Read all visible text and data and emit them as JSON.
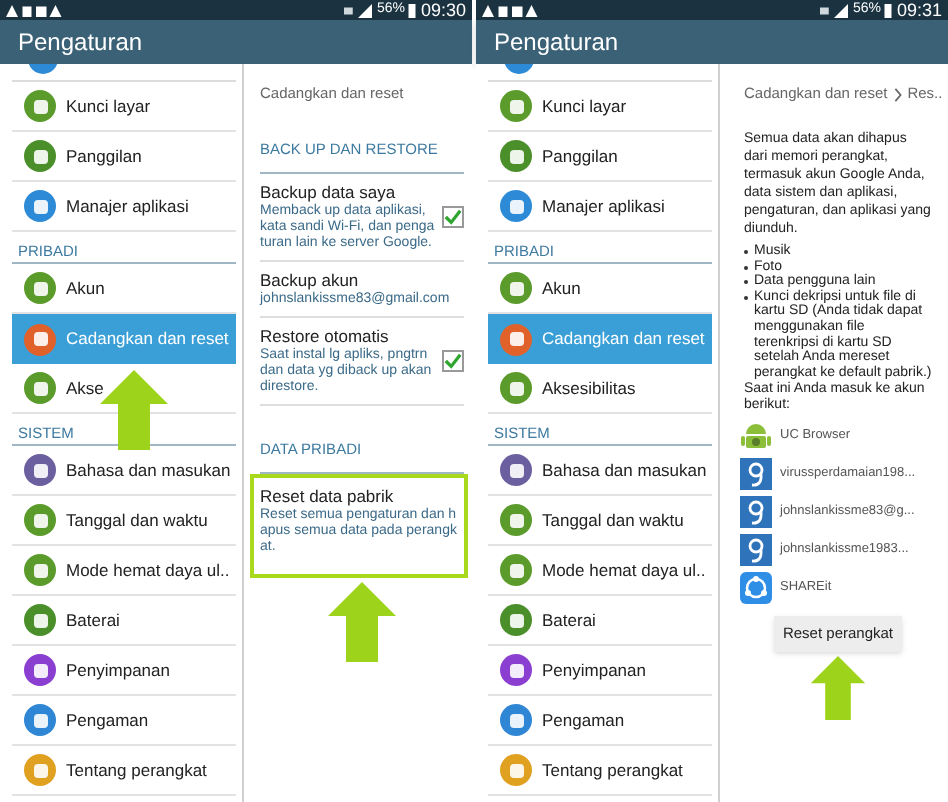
{
  "screens": [
    {
      "status_bar": {
        "battery": "56%",
        "time": "09:30"
      },
      "title": "Pengaturan",
      "list_arrow": true,
      "menu": [
        {
          "kind": "item",
          "label": "Kunci layar",
          "color": "#5b9b2b",
          "selected": false
        },
        {
          "kind": "item",
          "label": "Panggilan",
          "color": "#4b8f2a",
          "selected": false
        },
        {
          "kind": "item",
          "label": "Manajer aplikasi",
          "color": "#2d8ad6",
          "selected": false
        },
        {
          "kind": "header",
          "label": "PRIBADI"
        },
        {
          "kind": "item",
          "label": "Akun",
          "color": "#5b9b2b",
          "selected": false
        },
        {
          "kind": "item",
          "label": "Cadangkan dan reset",
          "color": "#e0622a",
          "selected": true
        },
        {
          "kind": "item",
          "label": "Akse",
          "color": "#5b9b2b",
          "selected": false
        },
        {
          "kind": "header",
          "label": "SISTEM"
        },
        {
          "kind": "item",
          "label": "Bahasa dan masukan",
          "color": "#6b5fa0",
          "selected": false
        },
        {
          "kind": "item",
          "label": "Tanggal dan waktu",
          "color": "#5b9b2b",
          "selected": false
        },
        {
          "kind": "item",
          "label": "Mode hemat daya ul..",
          "color": "#5b9b2b",
          "selected": false
        },
        {
          "kind": "item",
          "label": "Baterai",
          "color": "#4b8f2a",
          "selected": false
        },
        {
          "kind": "item",
          "label": "Penyimpanan",
          "color": "#8a3fd0",
          "selected": false
        },
        {
          "kind": "item",
          "label": "Pengaman",
          "color": "#2e86d4",
          "selected": false
        },
        {
          "kind": "item",
          "label": "Tentang perangkat",
          "color": "#e0a020",
          "selected": false
        }
      ],
      "detail": {
        "kind": "backup",
        "breadcrumb": [
          "Cadangkan dan reset"
        ],
        "sections": [
          {
            "header": "BACK UP DAN RESTORE",
            "items": [
              {
                "title": "Backup data saya",
                "description": "Memback up data aplikasi, kata sandi Wi-Fi, dan pengaturan lain ke server Google.",
                "checked": true,
                "highlighted": false
              },
              {
                "title": "Backup akun",
                "description": "johnslankissme83@gmail.com",
                "highlighted": false
              },
              {
                "title": "Restore otomatis",
                "description": "Saat instal lg apliks, pngtrn dan data yg diback up akan direstore.",
                "checked": true,
                "highlighted": false
              }
            ]
          },
          {
            "header": "DATA PRIBADI",
            "items": [
              {
                "title": "Reset data pabrik",
                "description": "Reset semua pengaturan dan hapus semua data pada perangkat.",
                "highlighted": true
              }
            ]
          }
        ]
      }
    },
    {
      "status_bar": {
        "battery": "56%",
        "time": "09:31"
      },
      "title": "Pengaturan",
      "menu": [
        {
          "kind": "item",
          "label": "Kunci layar",
          "color": "#5b9b2b",
          "selected": false
        },
        {
          "kind": "item",
          "label": "Panggilan",
          "color": "#4b8f2a",
          "selected": false
        },
        {
          "kind": "item",
          "label": "Manajer aplikasi",
          "color": "#2d8ad6",
          "selected": false
        },
        {
          "kind": "header",
          "label": "PRIBADI"
        },
        {
          "kind": "item",
          "label": "Akun",
          "color": "#5b9b2b",
          "selected": false
        },
        {
          "kind": "item",
          "label": "Cadangkan dan reset",
          "color": "#e0622a",
          "selected": true
        },
        {
          "kind": "item",
          "label": "Aksesibilitas",
          "color": "#5b9b2b",
          "selected": false
        },
        {
          "kind": "header",
          "label": "SISTEM"
        },
        {
          "kind": "item",
          "label": "Bahasa dan masukan",
          "color": "#6b5fa0",
          "selected": false
        },
        {
          "kind": "item",
          "label": "Tanggal dan waktu",
          "color": "#5b9b2b",
          "selected": false
        },
        {
          "kind": "item",
          "label": "Mode hemat daya ul..",
          "color": "#5b9b2b",
          "selected": false
        },
        {
          "kind": "item",
          "label": "Baterai",
          "color": "#4b8f2a",
          "selected": false
        },
        {
          "kind": "item",
          "label": "Penyimpanan",
          "color": "#8a3fd0",
          "selected": false
        },
        {
          "kind": "item",
          "label": "Pengaman",
          "color": "#2e86d4",
          "selected": false
        },
        {
          "kind": "item",
          "label": "Tentang perangkat",
          "color": "#e0a020",
          "selected": false
        }
      ],
      "detail": {
        "kind": "reset",
        "breadcrumb": [
          "Cadangkan dan reset",
          "Res.."
        ],
        "intro": "Semua data akan dihapus dari memori perangkat, termasuk akun Google Anda, data sistem dan aplikasi, pengaturan, dan aplikasi yang diunduh.",
        "bullets": [
          "Musik",
          "Foto",
          "Data pengguna lain",
          "Kunci dekripsi untuk file di kartu SD (Anda tidak dapat menggunakan file terenkripsi di kartu SD setelah Anda mereset perangkat ke default pabrik.)"
        ],
        "accounts_label": "Saat ini Anda masuk ke akun berikut:",
        "accounts": [
          {
            "kind": "android",
            "name": "UC Browser"
          },
          {
            "kind": "google",
            "name": "virussperdamaian198..."
          },
          {
            "kind": "google",
            "name": "johnslankissme83@g..."
          },
          {
            "kind": "google",
            "name": "johnslankissme1983..."
          },
          {
            "kind": "shareit",
            "name": "SHAREit"
          }
        ],
        "button": {
          "label": "Reset perangkat",
          "pointed": true
        }
      }
    }
  ]
}
